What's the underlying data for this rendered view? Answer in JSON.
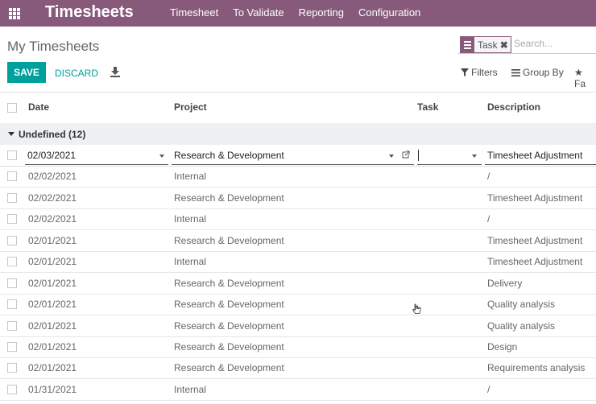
{
  "app": {
    "title": "Timesheets",
    "menu": [
      "Timesheet",
      "To Validate",
      "Reporting",
      "Configuration"
    ]
  },
  "breadcrumb": "My Timesheets",
  "search": {
    "facet_label": "Task",
    "placeholder": "Search..."
  },
  "toolbar": {
    "save": "SAVE",
    "discard": "DISCARD",
    "filters": "Filters",
    "group_by": "Group By",
    "favorites": "Fa"
  },
  "columns": {
    "date": "Date",
    "project": "Project",
    "task": "Task",
    "description": "Description"
  },
  "group": {
    "label": "Undefined (12)"
  },
  "edit_row": {
    "date": "02/03/2021",
    "project": "Research & Development",
    "task": "",
    "description": "Timesheet Adjustment"
  },
  "rows": [
    {
      "date": "02/02/2021",
      "project": "Internal",
      "description": "/"
    },
    {
      "date": "02/02/2021",
      "project": "Research & Development",
      "description": "Timesheet Adjustment"
    },
    {
      "date": "02/02/2021",
      "project": "Internal",
      "description": "/"
    },
    {
      "date": "02/01/2021",
      "project": "Research & Development",
      "description": "Timesheet Adjustment"
    },
    {
      "date": "02/01/2021",
      "project": "Internal",
      "description": "Timesheet Adjustment"
    },
    {
      "date": "02/01/2021",
      "project": "Research & Development",
      "description": "Delivery"
    },
    {
      "date": "02/01/2021",
      "project": "Research & Development",
      "description": "Quality analysis"
    },
    {
      "date": "02/01/2021",
      "project": "Research & Development",
      "description": "Quality analysis"
    },
    {
      "date": "02/01/2021",
      "project": "Research & Development",
      "description": "Design"
    },
    {
      "date": "02/01/2021",
      "project": "Research & Development",
      "description": "Requirements analysis"
    },
    {
      "date": "01/31/2021",
      "project": "Internal",
      "description": "/"
    }
  ],
  "colors": {
    "brand": "#875a7b",
    "accent": "#00a09d"
  }
}
